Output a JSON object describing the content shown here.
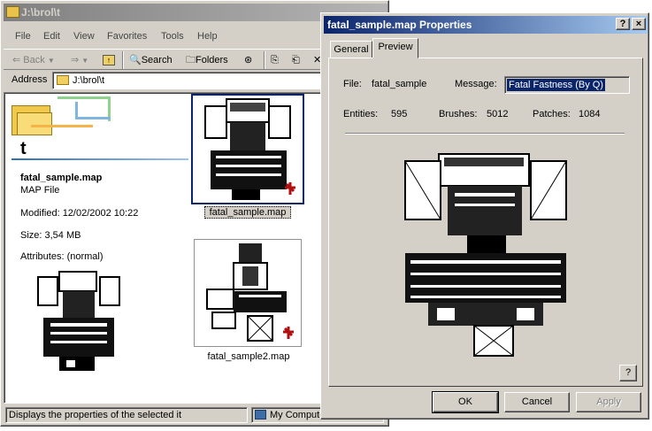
{
  "explorer": {
    "title": "J:\\brol\\t",
    "menu": [
      "File",
      "Edit",
      "View",
      "Favorites",
      "Tools",
      "Help"
    ],
    "toolbar": {
      "back": "Back",
      "search": "Search",
      "folders": "Folders"
    },
    "address_label": "Address",
    "address_value": "J:\\brol\\t",
    "folder_name": "t",
    "selected_file": {
      "name": "fatal_sample.map",
      "type": "MAP File",
      "modified": "Modified: 12/02/2002 10:22",
      "size": "Size: 3,54 MB",
      "attributes": "Attributes: (normal)"
    },
    "files": [
      "fatal_sample.map",
      "fatal_sample2.map"
    ],
    "status_left": "Displays the properties of the selected it",
    "status_right": "My Computer"
  },
  "dialog": {
    "title": "fatal_sample.map Properties",
    "help_caption": "?",
    "close_caption": "×",
    "tabs": [
      "General",
      "Preview"
    ],
    "active_tab": "Preview",
    "file_label": "File:",
    "file_value": "fatal_sample",
    "message_label": "Message:",
    "message_value": "Fatal Fastness (By Q)",
    "entities_label": "Entities:",
    "entities_value": "595",
    "brushes_label": "Brushes:",
    "brushes_value": "5012",
    "patches_label": "Patches:",
    "patches_value": "1084",
    "help_button": "?",
    "buttons": {
      "ok": "OK",
      "cancel": "Cancel",
      "apply": "Apply"
    }
  },
  "icons": {
    "map_badge_color": "#b01010",
    "title_active": "#0a246a",
    "title_inactive": "#808080"
  }
}
